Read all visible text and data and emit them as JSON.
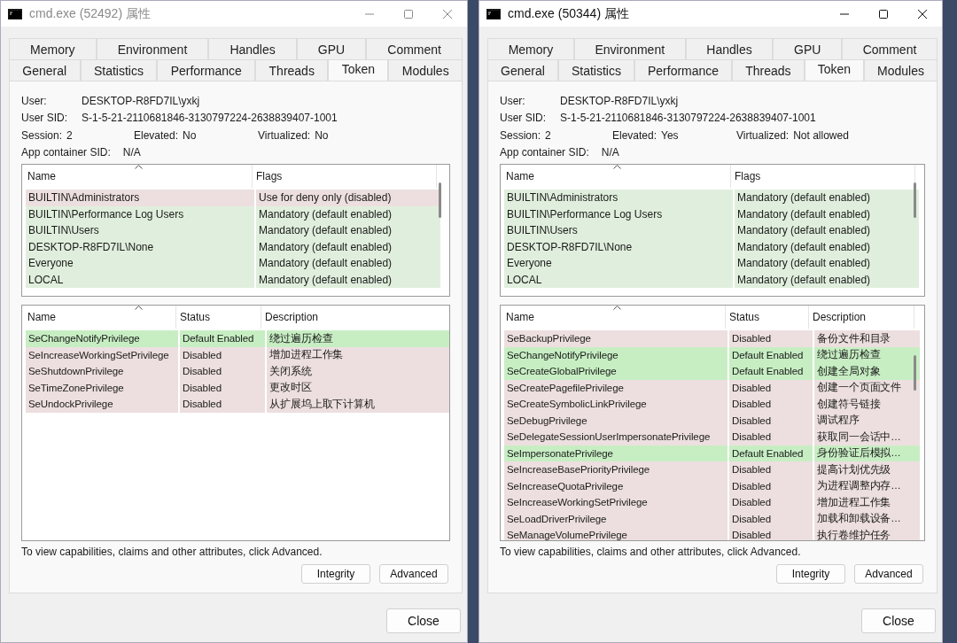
{
  "windows": [
    {
      "title": "cmd.exe (52492) 属性",
      "active": false,
      "tab_rows": [
        [
          {
            "label": "Memory",
            "selected": false
          },
          {
            "label": "Environment",
            "selected": false
          },
          {
            "label": "Handles",
            "selected": false
          },
          {
            "label": "GPU",
            "selected": false
          },
          {
            "label": "Comment",
            "selected": false
          }
        ],
        [
          {
            "label": "General",
            "selected": false
          },
          {
            "label": "Statistics",
            "selected": false
          },
          {
            "label": "Performance",
            "selected": false
          },
          {
            "label": "Threads",
            "selected": false
          },
          {
            "label": "Token",
            "selected": true
          },
          {
            "label": "Modules",
            "selected": false
          }
        ]
      ],
      "info": [
        [
          {
            "label": "User:",
            "value": "DESKTOP-R8FD7IL\\yxkj"
          }
        ],
        [
          {
            "label": "User SID:",
            "value": "S-1-5-21-2110681846-3130797224-2638839407-1001"
          }
        ],
        [
          {
            "label": "Session:",
            "value": "2"
          },
          {
            "label": "Elevated:",
            "value": "No"
          },
          {
            "label": "Virtualized:",
            "value": "No"
          }
        ],
        [
          {
            "label": "App container SID:",
            "value": "N/A"
          }
        ]
      ],
      "groups": {
        "columns": [
          "Name",
          "Flags"
        ],
        "rows": [
          {
            "name": "BUILTIN\\Administrators",
            "flags": "Use for deny only (disabled)",
            "enabled": false
          },
          {
            "name": "BUILTIN\\Performance Log Users",
            "flags": "Mandatory (default enabled)",
            "enabled": true
          },
          {
            "name": "BUILTIN\\Users",
            "flags": "Mandatory (default enabled)",
            "enabled": true
          },
          {
            "name": "DESKTOP-R8FD7IL\\None",
            "flags": "Mandatory (default enabled)",
            "enabled": true
          },
          {
            "name": "Everyone",
            "flags": "Mandatory (default enabled)",
            "enabled": true
          },
          {
            "name": "LOCAL",
            "flags": "Mandatory (default enabled)",
            "enabled": true
          }
        ]
      },
      "privileges": {
        "columns": [
          "Name",
          "Status",
          "Description"
        ],
        "rows": [
          {
            "name": "SeChangeNotifyPrivilege",
            "status": "Default Enabled",
            "description": "绕过遍历检查",
            "enabled": true
          },
          {
            "name": "SeIncreaseWorkingSetPrivilege",
            "status": "Disabled",
            "description": "增加进程工作集",
            "enabled": false
          },
          {
            "name": "SeShutdownPrivilege",
            "status": "Disabled",
            "description": "关闭系统",
            "enabled": false
          },
          {
            "name": "SeTimeZonePrivilege",
            "status": "Disabled",
            "description": "更改时区",
            "enabled": false
          },
          {
            "name": "SeUndockPrivilege",
            "status": "Disabled",
            "description": "从扩展坞上取下计算机",
            "enabled": false
          }
        ]
      },
      "hint": "To view capabilities, claims and other attributes, click Advanced.",
      "buttons": [
        "Integrity",
        "Advanced"
      ],
      "close_button": "Close"
    },
    {
      "title": "cmd.exe (50344) 属性",
      "active": true,
      "tab_rows": [
        [
          {
            "label": "Memory",
            "selected": false
          },
          {
            "label": "Environment",
            "selected": false
          },
          {
            "label": "Handles",
            "selected": false
          },
          {
            "label": "GPU",
            "selected": false
          },
          {
            "label": "Comment",
            "selected": false
          }
        ],
        [
          {
            "label": "General",
            "selected": false
          },
          {
            "label": "Statistics",
            "selected": false
          },
          {
            "label": "Performance",
            "selected": false
          },
          {
            "label": "Threads",
            "selected": false
          },
          {
            "label": "Token",
            "selected": true
          },
          {
            "label": "Modules",
            "selected": false
          }
        ]
      ],
      "info": [
        [
          {
            "label": "User:",
            "value": "DESKTOP-R8FD7IL\\yxkj"
          }
        ],
        [
          {
            "label": "User SID:",
            "value": "S-1-5-21-2110681846-3130797224-2638839407-1001"
          }
        ],
        [
          {
            "label": "Session:",
            "value": "2"
          },
          {
            "label": "Elevated:",
            "value": "Yes"
          },
          {
            "label": "Virtualized:",
            "value": "Not allowed"
          }
        ],
        [
          {
            "label": "App container SID:",
            "value": "N/A"
          }
        ]
      ],
      "groups": {
        "columns": [
          "Name",
          "Flags"
        ],
        "rows": [
          {
            "name": "BUILTIN\\Administrators",
            "flags": "Mandatory (default enabled)",
            "enabled": true
          },
          {
            "name": "BUILTIN\\Performance Log Users",
            "flags": "Mandatory (default enabled)",
            "enabled": true
          },
          {
            "name": "BUILTIN\\Users",
            "flags": "Mandatory (default enabled)",
            "enabled": true
          },
          {
            "name": "DESKTOP-R8FD7IL\\None",
            "flags": "Mandatory (default enabled)",
            "enabled": true
          },
          {
            "name": "Everyone",
            "flags": "Mandatory (default enabled)",
            "enabled": true
          },
          {
            "name": "LOCAL",
            "flags": "Mandatory (default enabled)",
            "enabled": true
          }
        ]
      },
      "privileges": {
        "columns": [
          "Name",
          "Status",
          "Description"
        ],
        "rows": [
          {
            "name": "SeBackupPrivilege",
            "status": "Disabled",
            "description": "备份文件和目录",
            "enabled": false
          },
          {
            "name": "SeChangeNotifyPrivilege",
            "status": "Default Enabled",
            "description": "绕过遍历检查",
            "enabled": true
          },
          {
            "name": "SeCreateGlobalPrivilege",
            "status": "Default Enabled",
            "description": "创建全局对象",
            "enabled": true
          },
          {
            "name": "SeCreatePagefilePrivilege",
            "status": "Disabled",
            "description": "创建一个页面文件",
            "enabled": false
          },
          {
            "name": "SeCreateSymbolicLinkPrivilege",
            "status": "Disabled",
            "description": "创建符号链接",
            "enabled": false
          },
          {
            "name": "SeDebugPrivilege",
            "status": "Disabled",
            "description": "调试程序",
            "enabled": false
          },
          {
            "name": "SeDelegateSessionUserImpersonatePrivilege",
            "status": "Disabled",
            "description": "获取同一会话中…",
            "enabled": false
          },
          {
            "name": "SeImpersonatePrivilege",
            "status": "Default Enabled",
            "description": "身份验证后模拟…",
            "enabled": true
          },
          {
            "name": "SeIncreaseBasePriorityPrivilege",
            "status": "Disabled",
            "description": "提高计划优先级",
            "enabled": false
          },
          {
            "name": "SeIncreaseQuotaPrivilege",
            "status": "Disabled",
            "description": "为进程调整内存…",
            "enabled": false
          },
          {
            "name": "SeIncreaseWorkingSetPrivilege",
            "status": "Disabled",
            "description": "增加进程工作集",
            "enabled": false
          },
          {
            "name": "SeLoadDriverPrivilege",
            "status": "Disabled",
            "description": "加载和卸载设备…",
            "enabled": false
          },
          {
            "name": "SeManageVolumePrivilege",
            "status": "Disabled",
            "description": "执行卷维护任务",
            "enabled": false
          }
        ]
      },
      "hint": "To view capabilities, claims and other attributes, click Advanced.",
      "buttons": [
        "Integrity",
        "Advanced"
      ],
      "close_button": "Close"
    }
  ]
}
